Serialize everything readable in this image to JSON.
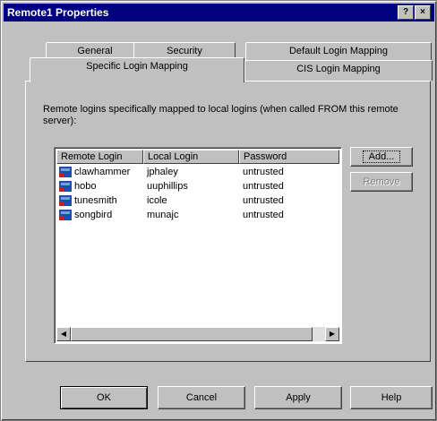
{
  "window": {
    "title": "Remote1 Properties",
    "help_glyph": "?",
    "close_glyph": "×"
  },
  "tabs": {
    "row1": [
      "General",
      "Security",
      "Default Login Mapping"
    ],
    "row2": [
      "Specific Login Mapping",
      "CIS Login Mapping"
    ],
    "active": "Specific Login Mapping"
  },
  "description": "Remote logins specifically mapped to local logins (when called FROM this remote server):",
  "listview": {
    "columns": [
      "Remote Login",
      "Local Login",
      "Password"
    ],
    "rows": [
      {
        "remote": "clawhammer",
        "local": "jphaley",
        "password": "untrusted",
        "icon": "user-icon"
      },
      {
        "remote": "hobo",
        "local": "uuphillips",
        "password": "untrusted",
        "icon": "user-icon"
      },
      {
        "remote": "tunesmith",
        "local": "icole",
        "password": "untrusted",
        "icon": "user-icon"
      },
      {
        "remote": "songbird",
        "local": "munajc",
        "password": "untrusted",
        "icon": "user-icon"
      }
    ]
  },
  "side_buttons": {
    "add": "Add...",
    "remove": "Remove"
  },
  "footer": {
    "ok": "OK",
    "cancel": "Cancel",
    "apply": "Apply",
    "help": "Help"
  },
  "colors": {
    "titlebar": "#000080",
    "face": "#c0c0c0"
  }
}
